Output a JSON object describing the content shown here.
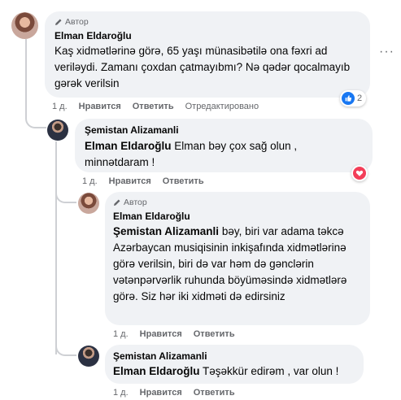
{
  "comments": [
    {
      "author_badge": "Автор",
      "name": "Elman Eldaroğlu",
      "mention": "",
      "text": "Kaş xidmətlərinə görə, 65 yaşı münasibətilə ona fəxri ad veriləydi. Zamanı çoxdan çatmayıbmı? Nə qədər qocalmayıb gərək verilsin",
      "time": "1 д.",
      "like_label": "Нравится",
      "reply_label": "Ответить",
      "edited_label": "Отредактировано",
      "reaction_count": "2",
      "reaction_icon": "thumbs-up",
      "reaction_color": "#1877f2"
    },
    {
      "author_badge": "",
      "name": "Şemistan Alizamanli",
      "mention": "Elman Eldaroğlu",
      "text": "Elman bəy çox sağ olun , minnətdaram !",
      "time": "1 д.",
      "like_label": "Нравится",
      "reply_label": "Ответить",
      "reaction_icon": "heart",
      "reaction_color": "#f33e58"
    },
    {
      "author_badge": "Автор",
      "name": "Elman Eldaroğlu",
      "mention": "Şemistan Alizamanli",
      "text": "bəy, biri var adama təkcə Azərbaycan musiqisinin inkişafında xidmətlərinə görə verilsin, biri də var həm də gənclərin vətənpərvərlik ruhunda böyüməsində xidmətlərə görə. Siz hər iki xidməti də edirsiniz",
      "time": "1 д.",
      "like_label": "Нравится",
      "reply_label": "Ответить"
    },
    {
      "author_badge": "",
      "name": "Şemistan Alizamanli",
      "mention": "Elman Eldaroğlu",
      "text": "Təşəkkür edirəm , var olun !",
      "time": "1 д.",
      "like_label": "Нравится",
      "reply_label": "Ответить"
    }
  ],
  "menu_icon": "more-horizontal-icon"
}
